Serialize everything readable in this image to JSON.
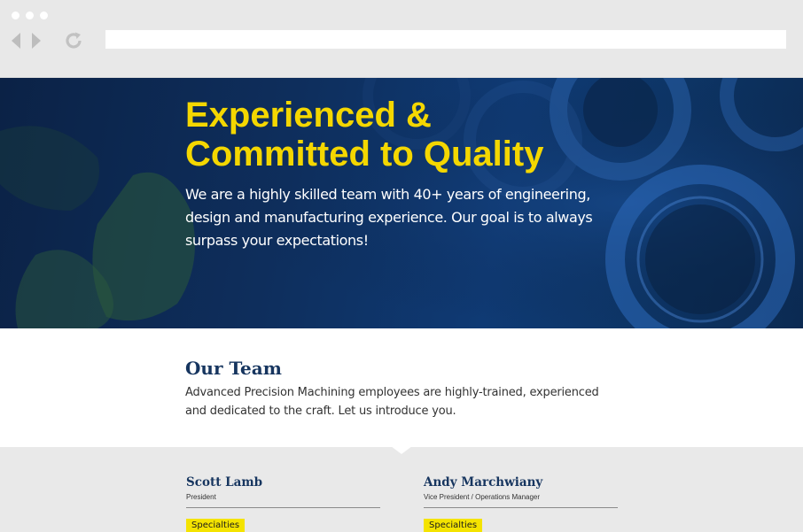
{
  "browser": {
    "address_value": ""
  },
  "hero": {
    "title_line1": "Experienced &",
    "title_line2": "Committed to Quality",
    "text": "We are a highly skilled team with 40+ years of engineering, design and manufacturing experience. Our goal is to always surpass your expectations!"
  },
  "team": {
    "title": "Our Team",
    "description": "Advanced Precision Machining employees are highly-trained, experienced and dedicated to the craft. Let us introduce you."
  },
  "members": [
    {
      "name": "Scott Lamb",
      "role": "President",
      "specialties_label": "Specialties"
    },
    {
      "name": "Andy Marchwiany",
      "role": "Vice President / Operations Manager",
      "specialties_label": "Specialties"
    }
  ],
  "colors": {
    "accent_yellow": "#f4d700",
    "navy": "#16355f",
    "hero_blue": "#0e2e5c"
  },
  "icons": [
    "back-arrow-icon",
    "forward-arrow-icon",
    "reload-icon"
  ]
}
